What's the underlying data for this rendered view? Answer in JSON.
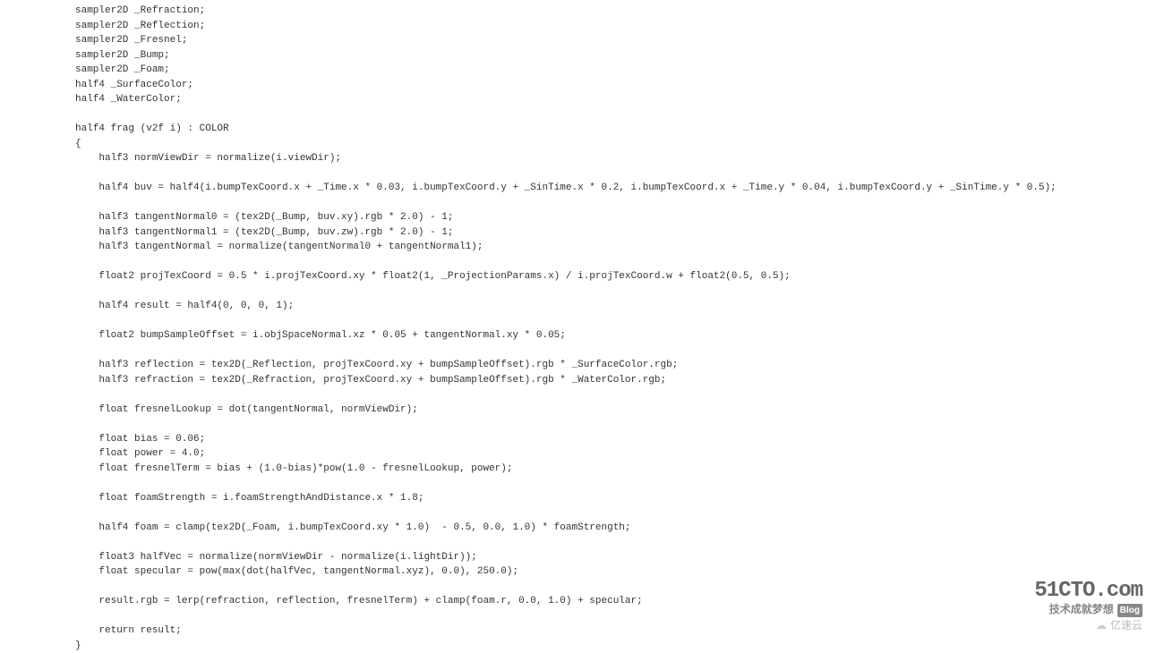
{
  "code": "sampler2D _Refraction;\nsampler2D _Reflection;\nsampler2D _Fresnel;\nsampler2D _Bump;\nsampler2D _Foam;\nhalf4 _SurfaceColor;\nhalf4 _WaterColor;\n\nhalf4 frag (v2f i) : COLOR\n{\n    half3 normViewDir = normalize(i.viewDir);\n\n    half4 buv = half4(i.bumpTexCoord.x + _Time.x * 0.03, i.bumpTexCoord.y + _SinTime.x * 0.2, i.bumpTexCoord.x + _Time.y * 0.04, i.bumpTexCoord.y + _SinTime.y * 0.5);\n\n    half3 tangentNormal0 = (tex2D(_Bump, buv.xy).rgb * 2.0) - 1;\n    half3 tangentNormal1 = (tex2D(_Bump, buv.zw).rgb * 2.0) - 1;\n    half3 tangentNormal = normalize(tangentNormal0 + tangentNormal1);\n\n    float2 projTexCoord = 0.5 * i.projTexCoord.xy * float2(1, _ProjectionParams.x) / i.projTexCoord.w + float2(0.5, 0.5);\n\n    half4 result = half4(0, 0, 0, 1);\n\n    float2 bumpSampleOffset = i.objSpaceNormal.xz * 0.05 + tangentNormal.xy * 0.05;\n\n    half3 reflection = tex2D(_Reflection, projTexCoord.xy + bumpSampleOffset).rgb * _SurfaceColor.rgb;\n    half3 refraction = tex2D(_Refraction, projTexCoord.xy + bumpSampleOffset).rgb * _WaterColor.rgb;\n\n    float fresnelLookup = dot(tangentNormal, normViewDir);\n\n    float bias = 0.06;\n    float power = 4.0;\n    float fresnelTerm = bias + (1.0-bias)*pow(1.0 - fresnelLookup, power);\n\n    float foamStrength = i.foamStrengthAndDistance.x * 1.8;\n\n    half4 foam = clamp(tex2D(_Foam, i.bumpTexCoord.xy * 1.0)  - 0.5, 0.0, 1.0) * foamStrength;\n\n    float3 halfVec = normalize(normViewDir - normalize(i.lightDir));\n    float specular = pow(max(dot(halfVec, tangentNormal.xyz), 0.0), 250.0);\n\n    result.rgb = lerp(refraction, reflection, fresnelTerm) + clamp(foam.r, 0.0, 1.0) + specular;\n\n    return result;\n}",
  "watermark": {
    "line1": "51CTO.com",
    "line2": "技术成就梦想",
    "blog": "Blog",
    "line3": "亿速云"
  }
}
